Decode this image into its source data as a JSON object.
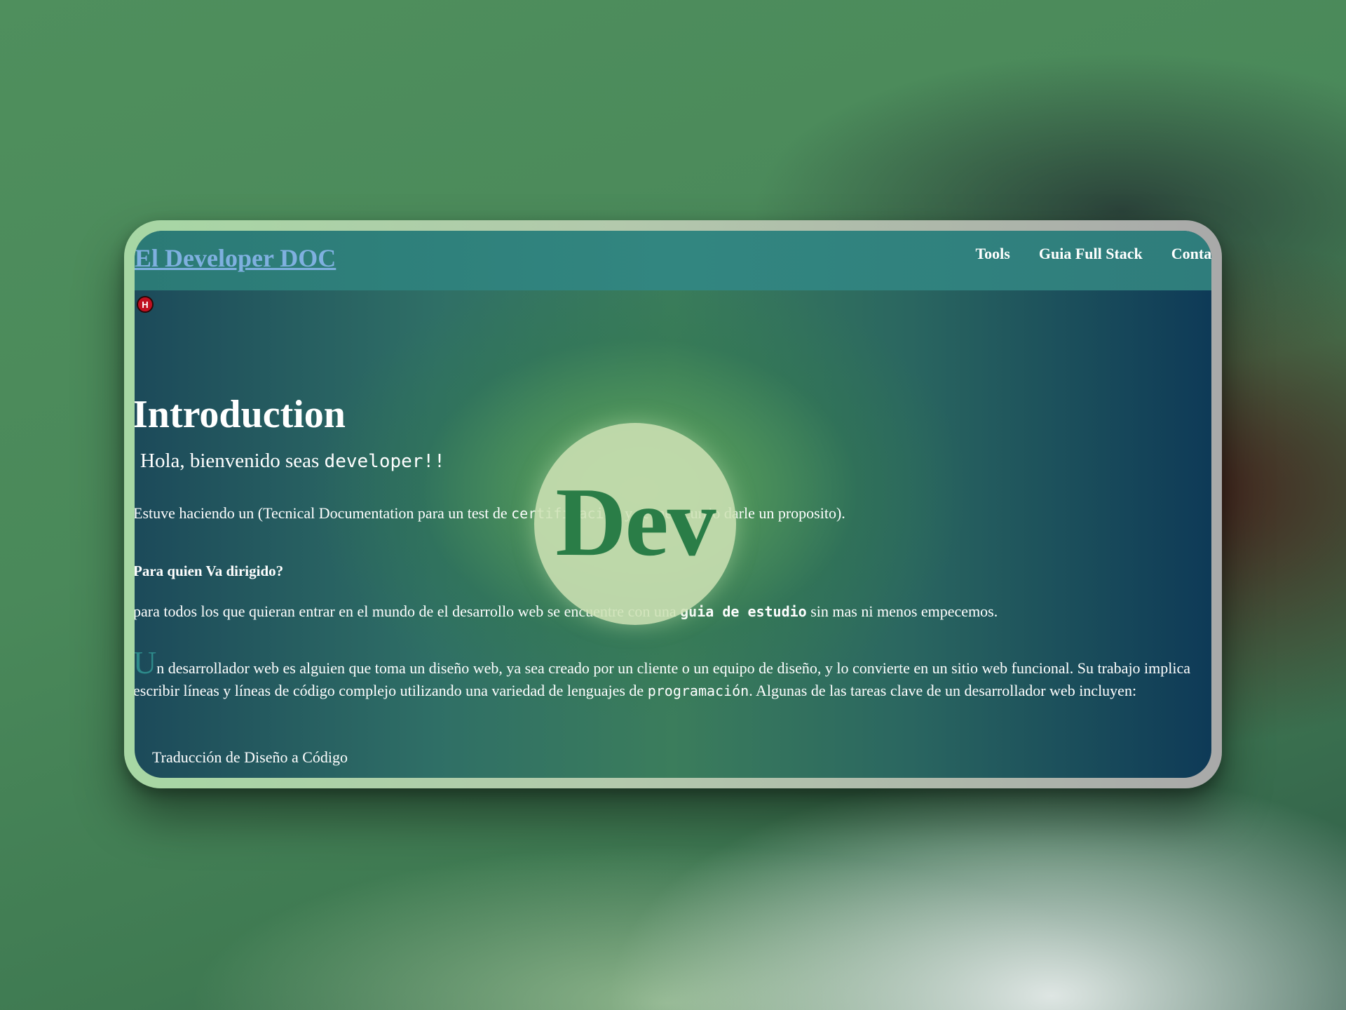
{
  "header": {
    "brand": "El Developer DOC",
    "nav": [
      {
        "label": "Tools"
      },
      {
        "label": "Guia Full Stack"
      },
      {
        "label": "Contac"
      }
    ]
  },
  "badge": {
    "letter": "H"
  },
  "main": {
    "title": "Introduction",
    "greeting_text": "Hola, bienvenido seas",
    "greeting_code": "developer!!",
    "intro_before": "Estuve haciendo un (Tecnical Documentation para un test de",
    "intro_code": "certificacion",
    "intro_after": "y se me ocurrio darle un proposito).",
    "target_heading": "Para quien Va dirigido?",
    "target_before": "para todos los que quieran entrar en el mundo de el desarrollo web se encuentre con una",
    "target_code": "guia de estudio",
    "target_after": "sin mas ni menos empecemos.",
    "dropcap": "U",
    "body_before": "n desarrollador web es alguien que toma un diseño web, ya sea creado por un cliente o un equipo de diseño, y lo convierte en un sitio web funcional. Su trabajo implica escribir líneas y líneas de código complejo utilizando una variedad de lenguajes de",
    "body_code": "programación",
    "body_after": ". Algunas de las tareas clave de un desarrollador web incluyen:",
    "list": [
      {
        "label": "Traducción de Diseño a Código"
      }
    ]
  },
  "logo": {
    "text": "Dev"
  },
  "colors": {
    "brand_link": "#7fb0e0",
    "header_bg": "#328680",
    "dropcap": "#2d8a8a",
    "logo_text": "#2a7d47"
  }
}
